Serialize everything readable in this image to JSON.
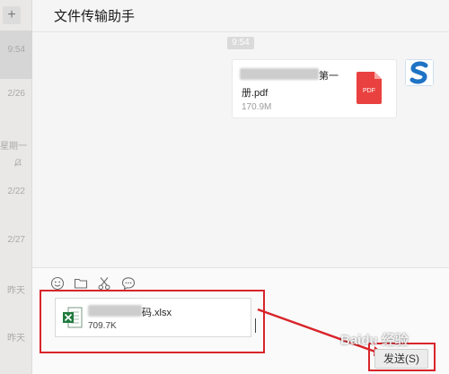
{
  "sidebar": {
    "add_button": "+",
    "items": [
      {
        "time": "9:54"
      },
      {
        "time": "2/26"
      },
      {
        "time": "星期一"
      },
      {
        "time": "2/22"
      },
      {
        "time": "2/27"
      },
      {
        "time": "昨天"
      },
      {
        "time": "昨天"
      }
    ]
  },
  "header": {
    "title": "文件传输助手"
  },
  "messages": {
    "timestamp": "9:54",
    "file": {
      "name_line1": "第一",
      "name_line2": "册.pdf",
      "size": "170.9M",
      "icon_label": "PDF"
    }
  },
  "composer": {
    "attachment": {
      "name": "码.xlsx",
      "size": "709.7K"
    },
    "send_label": "发送(S)"
  },
  "watermark": "Baidu 经验",
  "colors": {
    "highlight": "#d8252b",
    "pdf_red": "#e9413f",
    "excel_green": "#1f7a3e",
    "avatar_blue": "#1f73c4"
  }
}
